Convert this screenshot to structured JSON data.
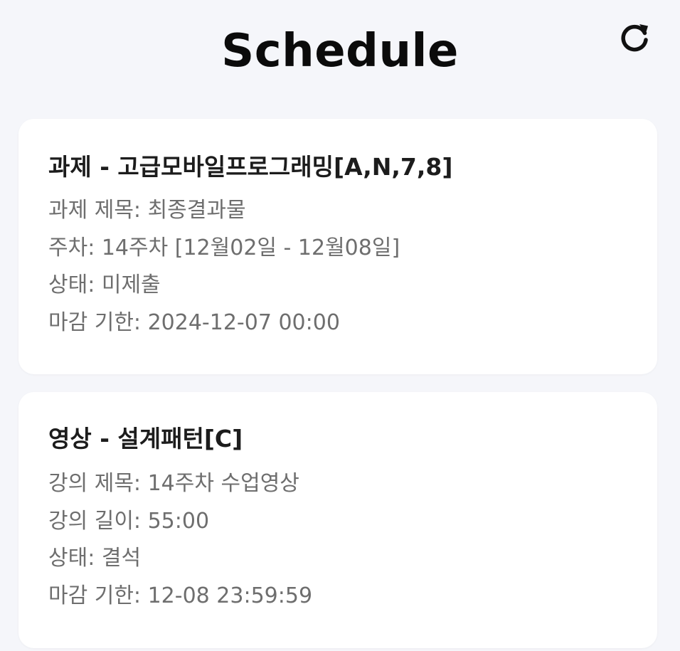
{
  "header": {
    "title": "Schedule",
    "refresh_icon": "refresh-icon"
  },
  "cards": [
    {
      "title": "과제 - 고급모바일프로그래밍[A,N,7,8]",
      "lines": [
        "과제 제목: 최종결과물",
        "주차: 14주차 [12월02일 - 12월08일]",
        "상태: 미제출",
        "마감 기한: 2024-12-07 00:00"
      ]
    },
    {
      "title": "영상 - 설계패턴[C]",
      "lines": [
        "강의 제목: 14주차 수업영상",
        "강의 길이: 55:00",
        "상태: 결석",
        "마감 기한: 12-08 23:59:59"
      ]
    }
  ],
  "colors": {
    "background": "#f5f6fa",
    "card": "#ffffff",
    "title_text": "#0b0b0b",
    "card_title_text": "#1c1c1c",
    "detail_text": "#6e6e6e"
  }
}
